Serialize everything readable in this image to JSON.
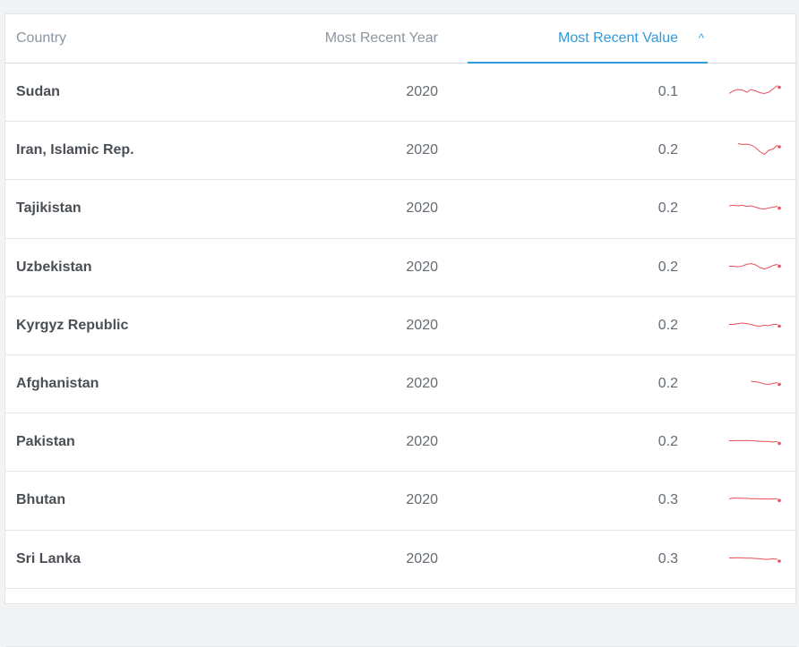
{
  "table": {
    "columns": {
      "country": "Country",
      "year": "Most Recent Year",
      "value": "Most Recent Value",
      "sort_icon": "chevron-up-icon"
    },
    "accent_color": "#2f9bdd",
    "sparkline_color": "#e8505b",
    "rows": [
      {
        "country": "Sudan",
        "year": "2020",
        "value": "0.1",
        "trend": [
          0.45,
          0.55,
          0.6,
          0.58,
          0.5,
          0.6,
          0.55,
          0.48,
          0.45,
          0.5,
          0.62,
          0.75
        ]
      },
      {
        "country": "Iran, Islamic Rep.",
        "year": "2020",
        "value": "0.2",
        "trend": [
          null,
          null,
          0.75,
          0.72,
          0.73,
          0.7,
          0.6,
          0.45,
          0.35,
          0.5,
          0.55,
          0.7
        ]
      },
      {
        "country": "Tajikistan",
        "year": "2020",
        "value": "0.2",
        "trend": [
          0.6,
          0.62,
          0.6,
          0.62,
          0.58,
          0.6,
          0.55,
          0.5,
          0.48,
          0.52,
          0.55,
          0.58
        ]
      },
      {
        "country": "Uzbekistan",
        "year": "2020",
        "value": "0.2",
        "trend": [
          0.55,
          0.55,
          0.53,
          0.56,
          0.62,
          0.65,
          0.6,
          0.5,
          0.45,
          0.5,
          0.58,
          0.62
        ]
      },
      {
        "country": "Kyrgyz Republic",
        "year": "2020",
        "value": "0.2",
        "trend": [
          0.55,
          0.55,
          0.58,
          0.6,
          0.58,
          0.55,
          0.5,
          0.48,
          0.52,
          0.5,
          0.55,
          0.55
        ]
      },
      {
        "country": "Afghanistan",
        "year": "2020",
        "value": "0.2",
        "trend": [
          null,
          null,
          null,
          null,
          null,
          0.6,
          0.58,
          0.55,
          0.5,
          0.48,
          0.52,
          0.55
        ]
      },
      {
        "country": "Pakistan",
        "year": "2020",
        "value": "0.2",
        "trend": [
          0.55,
          0.55,
          0.56,
          0.55,
          0.56,
          0.55,
          0.54,
          0.53,
          0.52,
          0.52,
          0.5,
          0.52
        ]
      },
      {
        "country": "Bhutan",
        "year": "2020",
        "value": "0.3",
        "trend": [
          0.55,
          0.58,
          0.58,
          0.57,
          0.57,
          0.56,
          0.56,
          0.55,
          0.55,
          0.54,
          0.55,
          0.56
        ]
      },
      {
        "country": "Sri Lanka",
        "year": "2020",
        "value": "0.3",
        "trend": [
          0.55,
          0.55,
          0.56,
          0.55,
          0.54,
          0.54,
          0.53,
          0.52,
          0.5,
          0.5,
          0.52,
          0.5
        ]
      },
      {
        "country": "",
        "year": "",
        "value": "",
        "trend": []
      }
    ]
  }
}
